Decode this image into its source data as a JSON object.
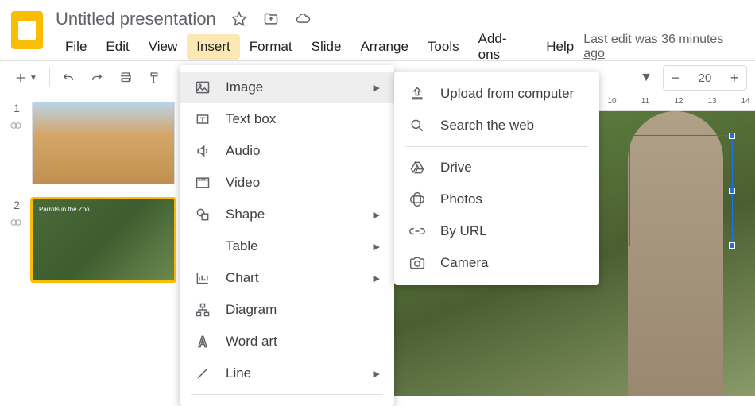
{
  "doc": {
    "name": "Untitled presentation"
  },
  "menubar": {
    "file": "File",
    "edit": "Edit",
    "view": "View",
    "insert": "Insert",
    "format": "Format",
    "slide": "Slide",
    "arrange": "Arrange",
    "tools": "Tools",
    "addons": "Add-ons",
    "help": "Help",
    "last_edit": "Last edit was 36 minutes ago"
  },
  "zoom": {
    "value": "20"
  },
  "ruler": {
    "ticks": [
      "10",
      "11",
      "12",
      "13",
      "14"
    ]
  },
  "slides": [
    {
      "num": "1",
      "caption": ""
    },
    {
      "num": "2",
      "caption": "Parrots in the Zoo"
    }
  ],
  "insert_menu": {
    "image": "Image",
    "textbox": "Text box",
    "audio": "Audio",
    "video": "Video",
    "shape": "Shape",
    "table": "Table",
    "chart": "Chart",
    "diagram": "Diagram",
    "wordart": "Word art",
    "line": "Line"
  },
  "image_menu": {
    "upload": "Upload from computer",
    "search": "Search the web",
    "drive": "Drive",
    "photos": "Photos",
    "byurl": "By URL",
    "camera": "Camera"
  }
}
